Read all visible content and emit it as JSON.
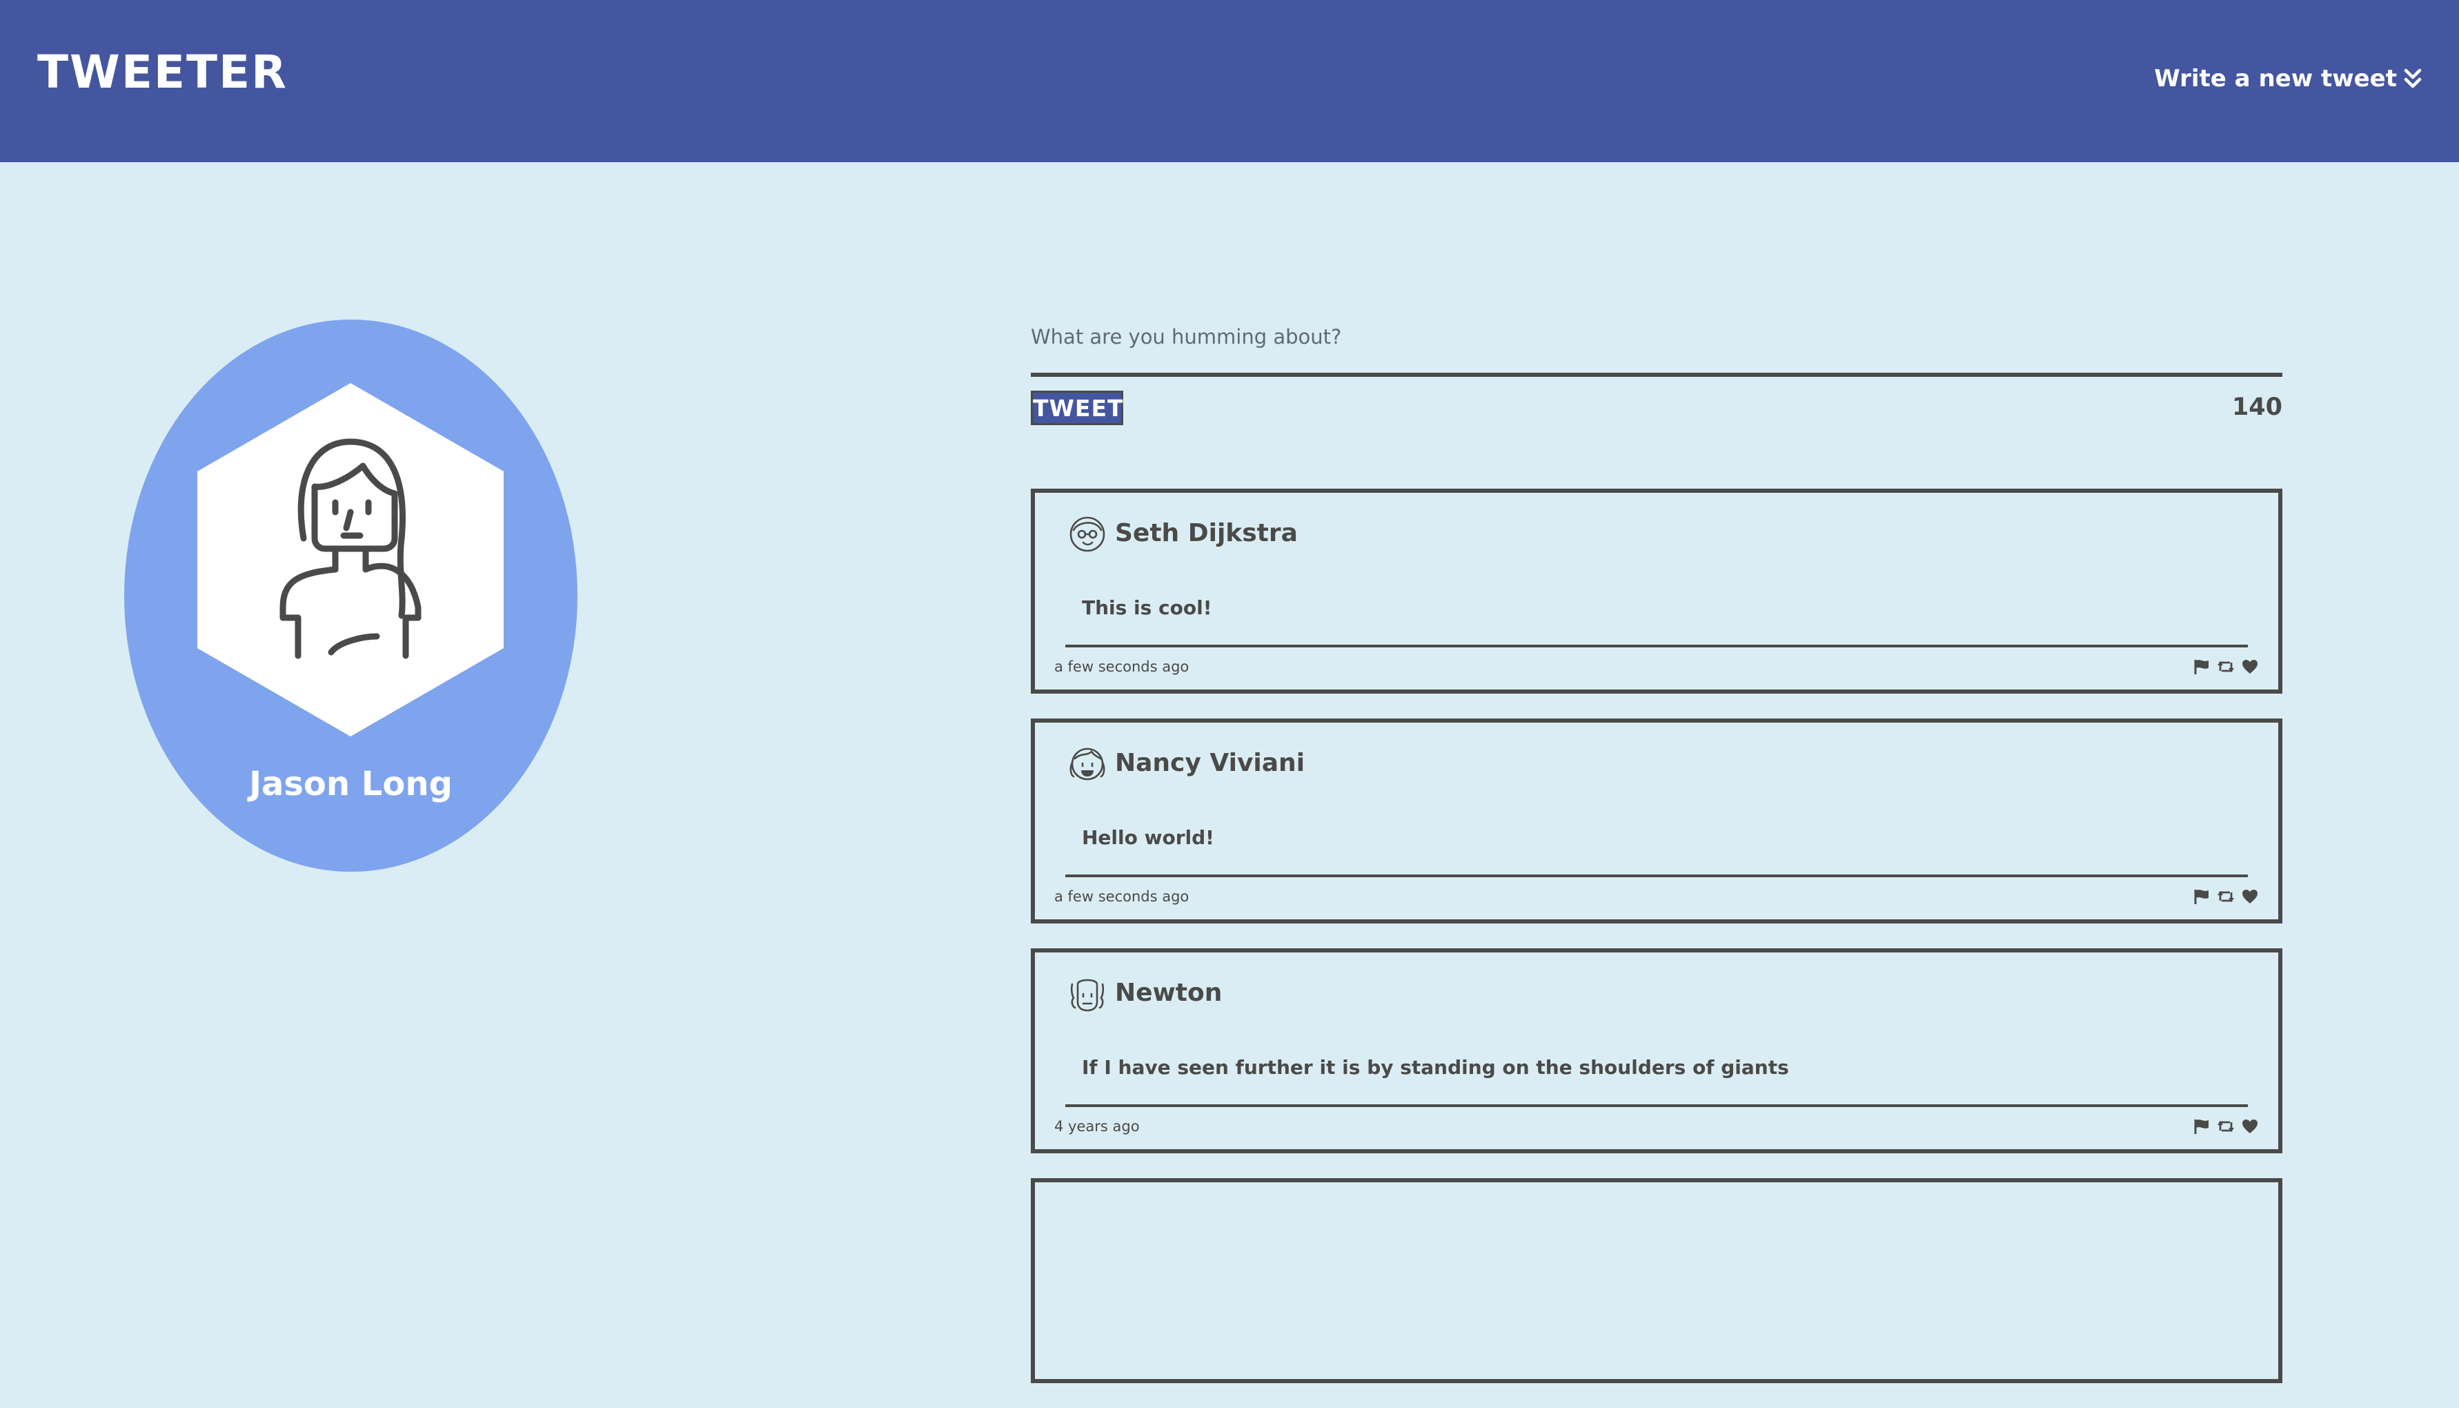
{
  "nav": {
    "brand": "TWEETER",
    "compose_label": "Write a new tweet",
    "compose_icon": "double-chevron-down-icon"
  },
  "profile": {
    "name": "Jason Long",
    "avatar_icon": "woman-avatar-icon"
  },
  "compose": {
    "placeholder": "What are you humming about?",
    "value": "",
    "button_label": "TWEET",
    "counter": "140"
  },
  "tweets": [
    {
      "author": "Seth Dijkstra",
      "text": "This is cool!",
      "time": "a few seconds ago",
      "avatar_icon": "man-glasses-avatar-icon"
    },
    {
      "author": "Nancy Viviani",
      "text": "Hello world!",
      "time": "a few seconds ago",
      "avatar_icon": "woman-pigtails-avatar-icon"
    },
    {
      "author": "Newton",
      "text": "If I have seen further it is by standing on the shoulders of giants",
      "time": "4 years ago",
      "avatar_icon": "man-wig-avatar-icon"
    }
  ],
  "tweet_action_icons": [
    "flag-icon",
    "retweet-icon",
    "heart-icon"
  ],
  "colors": {
    "nav_background": "#44569f",
    "page_background": "#dbedf4",
    "profile_circle": "#7fa4ee",
    "text_dark": "#4a4a48"
  }
}
